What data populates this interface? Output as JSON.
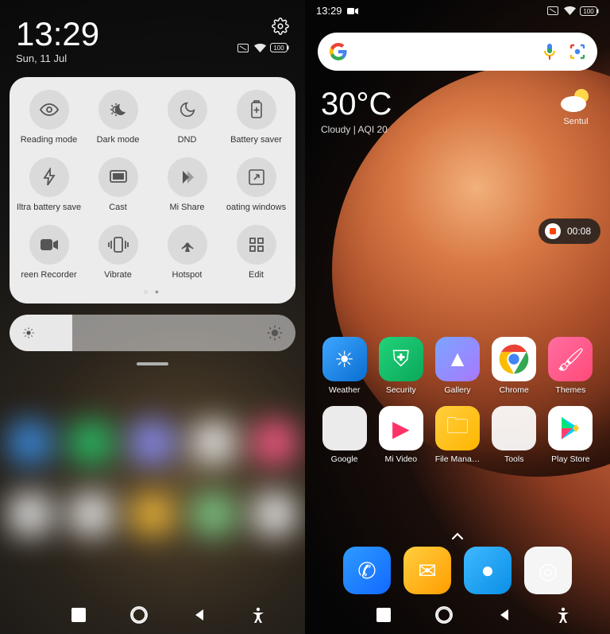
{
  "left": {
    "time": "13:29",
    "date": "Sun, 11 Jul",
    "battery": "100",
    "tiles": [
      {
        "label": "Reading mode",
        "icon": "eye"
      },
      {
        "label": "Dark mode",
        "icon": "darkmode"
      },
      {
        "label": "DND",
        "icon": "moon"
      },
      {
        "label": "Battery saver",
        "icon": "battery"
      },
      {
        "label": "Ultra battery saver",
        "icon": "bolt"
      },
      {
        "label": "Cast",
        "icon": "cast"
      },
      {
        "label": "Mi Share",
        "icon": "mishare"
      },
      {
        "label": "Floating windows",
        "icon": "float"
      },
      {
        "label": "Screen Recorder",
        "icon": "camcorder"
      },
      {
        "label": "Vibrate",
        "icon": "vibrate"
      },
      {
        "label": "Hotspot",
        "icon": "hotspot"
      },
      {
        "label": "Edit",
        "icon": "grid"
      }
    ]
  },
  "right": {
    "time": "13:29",
    "battery": "100",
    "weather": {
      "temp": "30°C",
      "desc": "Cloudy | AQI 20",
      "location": "Sentul"
    },
    "recording_time": "00:08",
    "apps_row1": [
      {
        "label": "Weather",
        "bg": "linear-gradient(135deg,#3ea6ff,#0a6ed1)",
        "glyph": "☀"
      },
      {
        "label": "Security",
        "bg": "linear-gradient(135deg,#22d37a,#0aa85a)",
        "glyph": "⛨"
      },
      {
        "label": "Gallery",
        "bg": "linear-gradient(135deg,#7aa5ff,#a978ff)",
        "glyph": "▲"
      },
      {
        "label": "Chrome",
        "bg": "#fff",
        "glyph": "chrome"
      },
      {
        "label": "Themes",
        "bg": "linear-gradient(135deg,#ff6ea0,#ff4a79)",
        "glyph": "🖌"
      }
    ],
    "apps_row2": [
      {
        "label": "Google",
        "bg": "folder",
        "glyph": "folder-google"
      },
      {
        "label": "Mi Video",
        "bg": "#fff",
        "glyph": "▶",
        "gcolor": "#ff3366"
      },
      {
        "label": "File Mana…",
        "bg": "linear-gradient(135deg,#ffcf3f,#ffb500)",
        "glyph": "🗀"
      },
      {
        "label": "Tools",
        "bg": "folder",
        "glyph": "folder-tools"
      },
      {
        "label": "Play Store",
        "bg": "#fff",
        "glyph": "play"
      }
    ],
    "dock": [
      {
        "name": "phone",
        "bg": "linear-gradient(135deg,#2f9bff,#1169ff)",
        "glyph": "✆"
      },
      {
        "name": "messages",
        "bg": "linear-gradient(135deg,#ffcf3f,#ff9d00)",
        "glyph": "✉"
      },
      {
        "name": "browser",
        "bg": "linear-gradient(135deg,#3fb8ff,#0a8fe6)",
        "glyph": "●"
      },
      {
        "name": "camera",
        "bg": "#f5f5f5",
        "glyph": "◎"
      }
    ]
  }
}
